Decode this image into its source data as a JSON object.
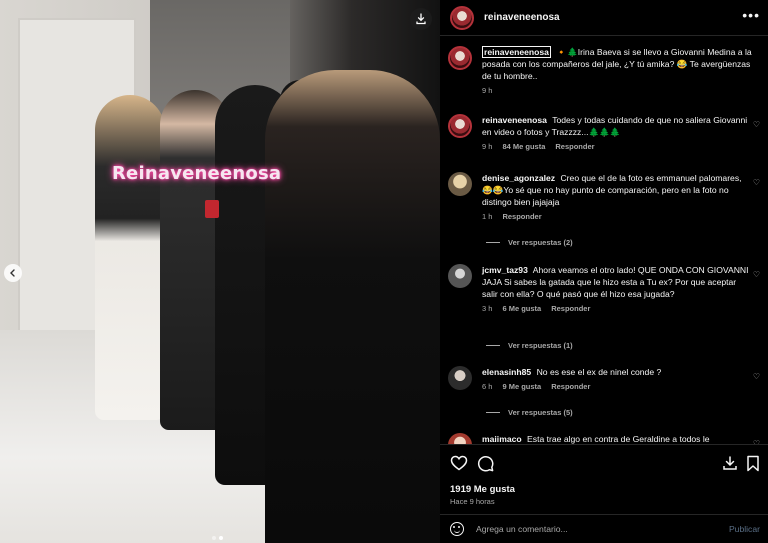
{
  "media": {
    "watermark": "Reinaveneenosa",
    "download_icon": "download-icon",
    "prev_icon": "chevron-left-icon",
    "carousel_pages": 2,
    "carousel_active": 1
  },
  "header": {
    "username": "reinaveneenosa",
    "more_icon": "more-horizontal-icon"
  },
  "caption": {
    "username": "reinaveneenosa",
    "text": "🔸🌲Irina Baeva si se llevo a Giovanni Medina a la posada con los compañeros del jale, ¿Y tú amika? 😂 Te avergüenzas de tu hombre..",
    "time": "9 h"
  },
  "comments": [
    {
      "username": "reinaveneenosa",
      "text": "Todes y todas cuidando de que no saliera Giovanni en video o fotos y Trazzzz...🌲🌲🌲",
      "time": "9 h",
      "likes": "84 Me gusta",
      "reply": "Responder"
    },
    {
      "username": "denise_agonzalez",
      "text": "Creo que el de la foto es emmanuel palomares, 😂😂Yo sé que no hay punto de comparación, pero en la foto no distingo bien jajajaja",
      "time": "1 h",
      "reply": "Responder",
      "view_replies": "Ver respuestas (2)"
    },
    {
      "username": "jcmv_taz93",
      "text": "Ahora veamos el otro lado! QUE ONDA CON GIOVANNI JAJA Si sabes la gatada que le hizo esta a Tu ex? Por que aceptar salir con ella? O qué pasó que él hizo esa jugada?",
      "time": "3 h",
      "likes": "6 Me gusta",
      "reply": "Responder",
      "view_replies": "Ver respuestas (1)"
    },
    {
      "username": "elenasinh85",
      "text": "No es ese el ex de ninel conde ?",
      "time": "6 h",
      "likes": "9 Me gusta",
      "reply": "Responder",
      "view_replies": "Ver respuestas (5)"
    },
    {
      "username": "maiimaco",
      "text": "Esta trae algo en contra de Geraldine a todos le"
    }
  ],
  "actions": {
    "like_icon": "heart-icon",
    "comment_icon": "comment-icon",
    "share_icon": "share-icon",
    "save_icon": "bookmark-icon",
    "likes": "1919 Me gusta",
    "ago": "Hace 9 horas"
  },
  "add_comment": {
    "placeholder": "Agrega un comentario...",
    "post_label": "Publicar"
  }
}
